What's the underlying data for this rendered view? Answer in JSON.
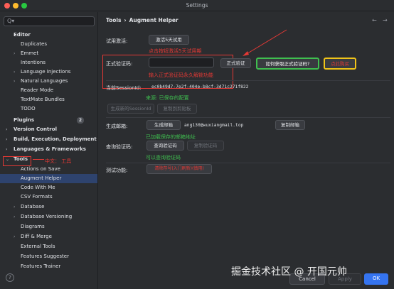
{
  "window": {
    "title": "Settings"
  },
  "search": {
    "placeholder": "Q▾"
  },
  "sidebar": {
    "items": [
      {
        "label": "Editor",
        "section": true
      },
      {
        "label": "Duplicates"
      },
      {
        "label": "Emmet"
      },
      {
        "label": "Intentions"
      },
      {
        "label": "Language Injections"
      },
      {
        "label": "Natural Languages"
      },
      {
        "label": "Reader Mode"
      },
      {
        "label": "TextMate Bundles"
      },
      {
        "label": "TODO"
      },
      {
        "label": "Plugins",
        "section": true,
        "badge": "2"
      },
      {
        "label": "Version Control",
        "section": true
      },
      {
        "label": "Build, Execution, Deployment",
        "section": true
      },
      {
        "label": "Languages & Frameworks",
        "section": true
      },
      {
        "label": "Tools",
        "section": true
      },
      {
        "label": "Actions on Save"
      },
      {
        "label": "Augment Helper"
      },
      {
        "label": "Code With Me"
      },
      {
        "label": "CSV Formats"
      },
      {
        "label": "Database"
      },
      {
        "label": "Database Versioning"
      },
      {
        "label": "Diagrams"
      },
      {
        "label": "Diff & Merge"
      },
      {
        "label": "External Tools"
      },
      {
        "label": "Features Suggester"
      },
      {
        "label": "Features Trainer"
      }
    ],
    "annotation": "中文：  工具"
  },
  "breadcrumb": {
    "parent": "Tools",
    "sep": "›",
    "current": "Augment Helper"
  },
  "trial": {
    "label": "试用激活:",
    "button": "激活5天试用",
    "hint": "点击按钮激活5天试用期"
  },
  "license": {
    "label": "正式验证码:",
    "input_value": "",
    "verify_button": "正式验证",
    "get_code_button": "如何获取正式验证码?",
    "buy_button": "点此购买",
    "hint": "输入正式验证码永久解锁功能"
  },
  "session": {
    "label": "当前SessionId:",
    "value": "ec0b49d7-7e2f-404e-b8cf-3d71c271f822",
    "source": "来源: 已保存的配置",
    "gen_button": "生成新的SessionId",
    "copy_button": "复制到剪贴板"
  },
  "email": {
    "label": "生成邮箱:",
    "gen_button": "生成邮箱",
    "value": "ang130@wuxiangmail.top",
    "copy_button": "复制邮箱",
    "hint": "已加载保存的邮箱地址"
  },
  "query": {
    "label": "查询验证码:",
    "query_button": "查询验证码",
    "copy_button": "复制验证码",
    "hint": "可以查询验证码"
  },
  "test": {
    "label": "测试功能:",
    "button": "清除存号(入门刷新)(慎用)"
  },
  "footer": {
    "cancel": "Cancel",
    "apply": "Apply",
    "ok": "OK"
  },
  "watermark": "掘金技术社区 @ 开国元帅",
  "colors": {
    "accent": "#3574f0",
    "annotation": "#e53935",
    "selected": "#2e436e",
    "green_box": "#3fbf4f",
    "yellow_box": "#f0c419"
  }
}
